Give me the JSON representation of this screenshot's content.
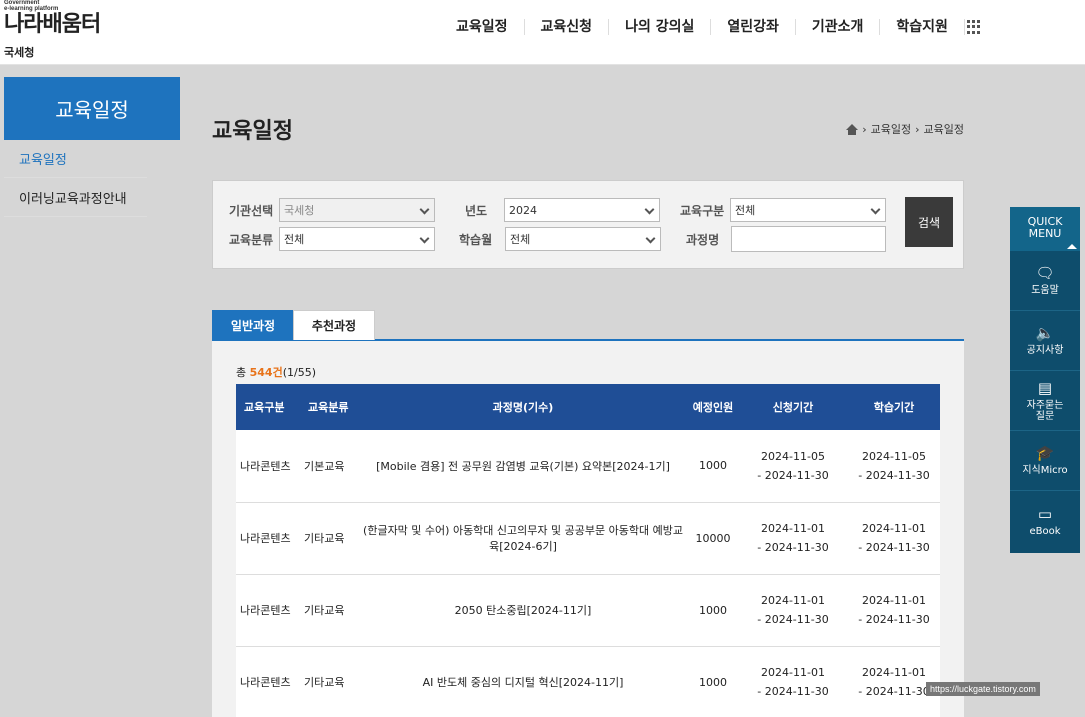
{
  "logo": {
    "en_line1": "Government",
    "en_line2": "e-learning platform",
    "title": "나라배움터",
    "org": "국세청"
  },
  "gnb": {
    "items": [
      "교육일정",
      "교육신청",
      "나의 강의실",
      "열린강좌",
      "기관소개",
      "학습지원"
    ]
  },
  "lnb": {
    "title": "교육일정",
    "items": [
      "교육일정",
      "이러닝교육과정안내"
    ]
  },
  "page": {
    "title": "교육일정",
    "breadcrumb": [
      "교육일정",
      "교육일정"
    ]
  },
  "search": {
    "org_label": "기관선택",
    "org_value": "국세청",
    "year_label": "년도",
    "year_value": "2024",
    "type_label": "교육구분",
    "type_value": "전체",
    "cat_label": "교육분류",
    "cat_value": "전체",
    "month_label": "학습월",
    "month_value": "전체",
    "course_label": "과정명",
    "course_value": "",
    "button": "검색"
  },
  "tabs": [
    "일반과정",
    "추천과정"
  ],
  "list": {
    "total_prefix": "총 ",
    "total_count": "544건",
    "total_pages": "(1/55)",
    "headers": [
      "교육구분",
      "교육분류",
      "과정명(기수)",
      "예정인원",
      "신청기간",
      "학습기간"
    ],
    "rows": [
      {
        "type": "나라콘텐츠",
        "cat": "기본교육",
        "name": "[Mobile 겸용] 전 공무원 감염병 교육(기본) 요약본[2024-1기]",
        "cap": "1000",
        "apply_start": "2024-11-05",
        "apply_end": "- 2024-11-30",
        "study_start": "2024-11-05",
        "study_end": "- 2024-11-30"
      },
      {
        "type": "나라콘텐츠",
        "cat": "기타교육",
        "name": "(한글자막 및 수어) 아동학대 신고의무자 및 공공부문 아동학대 예방교육[2024-6기]",
        "cap": "10000",
        "apply_start": "2024-11-01",
        "apply_end": "- 2024-11-30",
        "study_start": "2024-11-01",
        "study_end": "- 2024-11-30"
      },
      {
        "type": "나라콘텐츠",
        "cat": "기타교육",
        "name": "2050 탄소중립[2024-11기]",
        "cap": "1000",
        "apply_start": "2024-11-01",
        "apply_end": "- 2024-11-30",
        "study_start": "2024-11-01",
        "study_end": "- 2024-11-30"
      },
      {
        "type": "나라콘텐츠",
        "cat": "기타교육",
        "name": "AI 반도체 중심의 디지털 혁신[2024-11기]",
        "cap": "1000",
        "apply_start": "2024-11-01",
        "apply_end": "- 2024-11-30",
        "study_start": "2024-11-01",
        "study_end": "- 2024-11-30"
      }
    ]
  },
  "quick": {
    "title_line1": "QUICK",
    "title_line2": "MENU",
    "items": [
      {
        "label": "도움말"
      },
      {
        "label": "공지사항"
      },
      {
        "label": "자주묻는 질문"
      },
      {
        "label": "지식Micro"
      },
      {
        "label": "eBook"
      }
    ]
  },
  "watermark": "https://luckgate.tistory.com"
}
